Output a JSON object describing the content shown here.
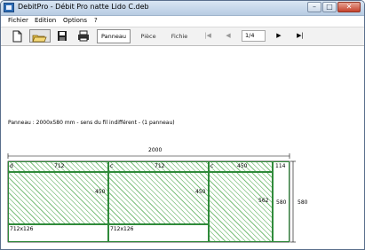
{
  "window": {
    "title": "DebitPro - Débit Pro natte Lido C.deb",
    "controls": {
      "minimize": "–",
      "maximize": "□",
      "close": "✕"
    }
  },
  "menu": [
    "Fichier",
    "Edition",
    "Options",
    "?"
  ],
  "toolbar": {
    "tabs": [
      "Panneau",
      "Pièce",
      "Fichie"
    ],
    "page": "1/4"
  },
  "panel": {
    "info": "Panneau : 2000x580 mm - sens du fil indifférent - (1 panneau)",
    "width_label": "2000",
    "height_label_outer": "580",
    "height_label_inner": "580",
    "waste_width": "114",
    "pieces": [
      {
        "marker": "d",
        "width": "712",
        "height": "450",
        "offcut": "712x126"
      },
      {
        "marker": "c",
        "width": "712",
        "height": "450",
        "offcut": "712x126"
      },
      {
        "marker": "c",
        "width": "450",
        "height": "562"
      }
    ]
  }
}
